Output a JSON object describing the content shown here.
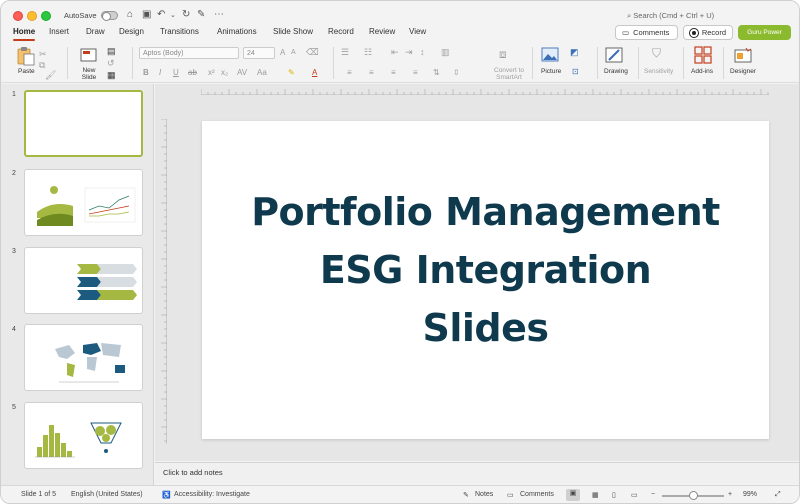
{
  "titlebar": {
    "autosave_label": "AutoSave",
    "search_placeholder": "Search (Cmd + Ctrl + U)"
  },
  "tabs": [
    {
      "label": "Home"
    },
    {
      "label": "Insert"
    },
    {
      "label": "Draw"
    },
    {
      "label": "Design"
    },
    {
      "label": "Transitions"
    },
    {
      "label": "Animations"
    },
    {
      "label": "Slide Show"
    },
    {
      "label": "Record"
    },
    {
      "label": "Review"
    },
    {
      "label": "View"
    }
  ],
  "actions": {
    "comments_label": "Comments",
    "record_label": "Record",
    "guru_label": "Guru Power"
  },
  "ribbon": {
    "paste_label": "Paste",
    "new_slide_label": "New Slide",
    "font_name": "Aptos (Body)",
    "font_size": "24",
    "convert_label": "Convert to SmartArt",
    "picture_label": "Picture",
    "drawing_label": "Drawing",
    "sensitivity_label": "Sensitivity",
    "addins_label": "Add-ins",
    "designer_label": "Designer"
  },
  "slides": {
    "numbers": [
      "1",
      "2",
      "3",
      "4",
      "5"
    ],
    "selected": 1
  },
  "main_slide": {
    "title_line1": "Portfolio Management",
    "title_line2": "ESG Integration",
    "title_line3": "Slides",
    "title_color": "#0f3a4e"
  },
  "notes": {
    "placeholder": "Click to add notes"
  },
  "status": {
    "slide_counter": "Slide 1 of 5",
    "language": "English (United States)",
    "accessibility": "Accessibility: Investigate",
    "notes_label": "Notes",
    "comments_label": "Comments",
    "zoom": "99%"
  },
  "colors": {
    "accent_red": "#c43e1c",
    "guru_green": "#8cba2e",
    "thumb_green": "#a5b842",
    "slide_navy": "#0f3a4e"
  }
}
